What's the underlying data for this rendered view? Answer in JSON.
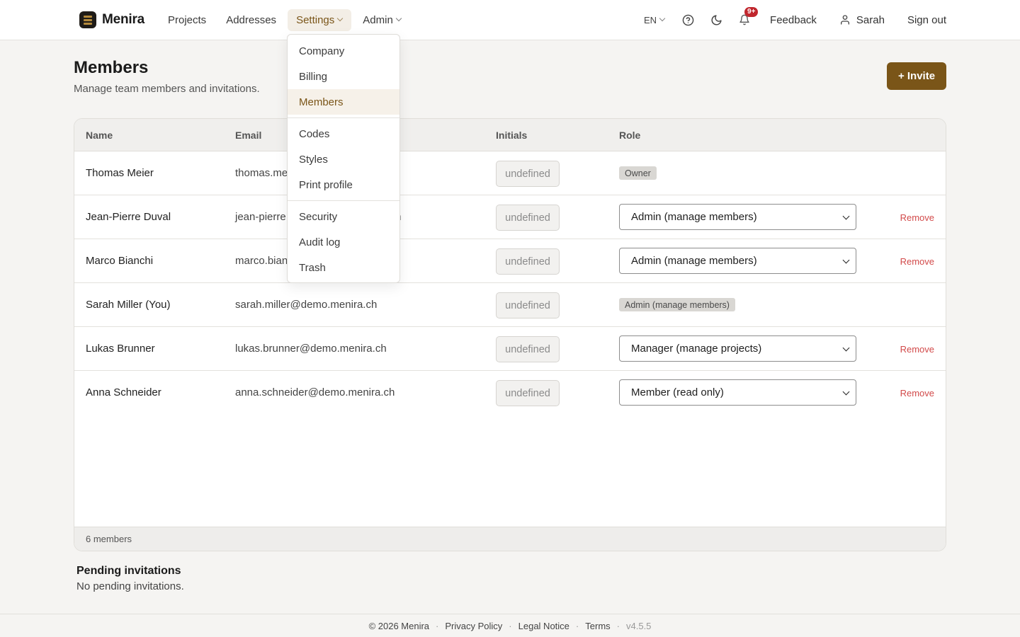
{
  "brand": {
    "name": "Menira"
  },
  "nav": {
    "projects": "Projects",
    "addresses": "Addresses",
    "settings": "Settings",
    "admin": "Admin"
  },
  "right_nav": {
    "language": "EN",
    "notifications_badge": "9+",
    "feedback": "Feedback",
    "user": "Sarah",
    "sign_out": "Sign out"
  },
  "settings_menu": {
    "items": [
      "Company",
      "Billing",
      "Members",
      "Codes",
      "Styles",
      "Print profile",
      "Security",
      "Audit log",
      "Trash"
    ],
    "active": "Members"
  },
  "page": {
    "title": "Members",
    "subtitle": "Manage team members and invitations.",
    "invite_label": "+ Invite"
  },
  "table": {
    "columns": {
      "name": "Name",
      "email": "Email",
      "initials": "Initials",
      "role": "Role"
    },
    "rows": [
      {
        "name": "Thomas Meier",
        "email": "thomas.meier@demo.menira.ch",
        "initials": "undefined",
        "role": "Owner",
        "editable": false,
        "remove": ""
      },
      {
        "name": "Jean-Pierre Duval",
        "email": "jean-pierre.duval@demo.menira.ch",
        "initials": "undefined",
        "role": "Admin (manage members)",
        "editable": true,
        "remove": "Remove"
      },
      {
        "name": "Marco Bianchi",
        "email": "marco.bianchi@demo.menira.ch",
        "initials": "undefined",
        "role": "Admin (manage members)",
        "editable": true,
        "remove": "Remove"
      },
      {
        "name": "Sarah Miller (You)",
        "email": "sarah.miller@demo.menira.ch",
        "initials": "undefined",
        "role": "Admin (manage members)",
        "editable": false,
        "remove": ""
      },
      {
        "name": "Lukas Brunner",
        "email": "lukas.brunner@demo.menira.ch",
        "initials": "undefined",
        "role": "Manager (manage projects)",
        "editable": true,
        "remove": "Remove"
      },
      {
        "name": "Anna Schneider",
        "email": "anna.schneider@demo.menira.ch",
        "initials": "undefined",
        "role": "Member (read only)",
        "editable": true,
        "remove": "Remove"
      }
    ],
    "footer": "6 members"
  },
  "pending": {
    "title": "Pending invitations",
    "empty_text": "No pending invitations."
  },
  "footer": {
    "copyright": "© 2026 Menira",
    "privacy": "Privacy Policy",
    "legal": "Legal Notice",
    "terms": "Terms",
    "version": "v4.5.5"
  },
  "colors": {
    "accent": "#7a5518",
    "accent_light": "#f6f1e9",
    "danger": "#d24a4a",
    "badge": "#c0262d"
  }
}
